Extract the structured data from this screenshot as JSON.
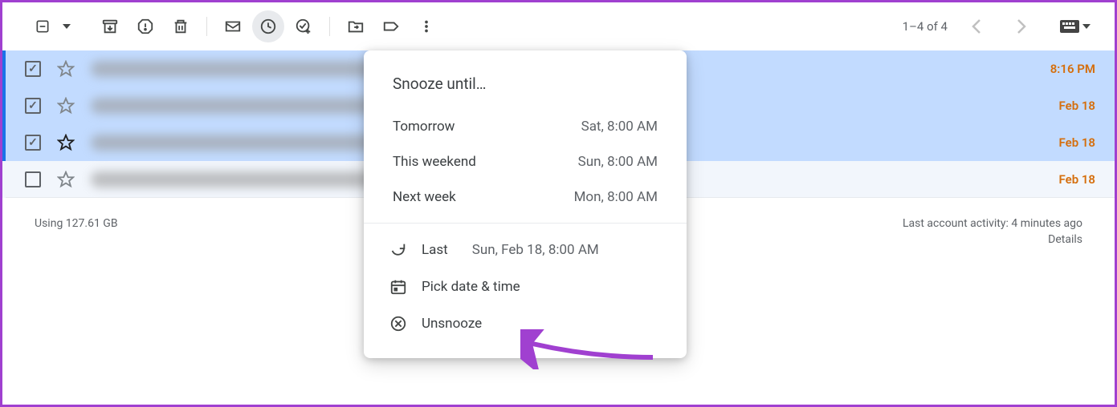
{
  "toolbar": {
    "select_expanded": false
  },
  "pagination": {
    "text": "1–4 of 4"
  },
  "snooze": {
    "title": "Snooze until…",
    "options": [
      {
        "label": "Tomorrow",
        "time": "Sat, 8:00 AM"
      },
      {
        "label": "This weekend",
        "time": "Sun, 8:00 AM"
      },
      {
        "label": "Next week",
        "time": "Mon, 8:00 AM"
      }
    ],
    "last_label": "Last",
    "last_time": "Sun, Feb 18, 8:00 AM",
    "pick_label": "Pick date & time",
    "unsnooze_label": "Unsnooze"
  },
  "rows": [
    {
      "selected": true,
      "starred": false,
      "time": "8:16 PM"
    },
    {
      "selected": true,
      "starred": false,
      "time": "Feb 18"
    },
    {
      "selected": true,
      "starred": true,
      "time": "Feb 18"
    },
    {
      "selected": false,
      "starred": false,
      "time": "Feb 18"
    }
  ],
  "footer": {
    "storage": "Using 127.61 GB",
    "activity": "Last account activity: 4 minutes ago",
    "details": "Details"
  }
}
